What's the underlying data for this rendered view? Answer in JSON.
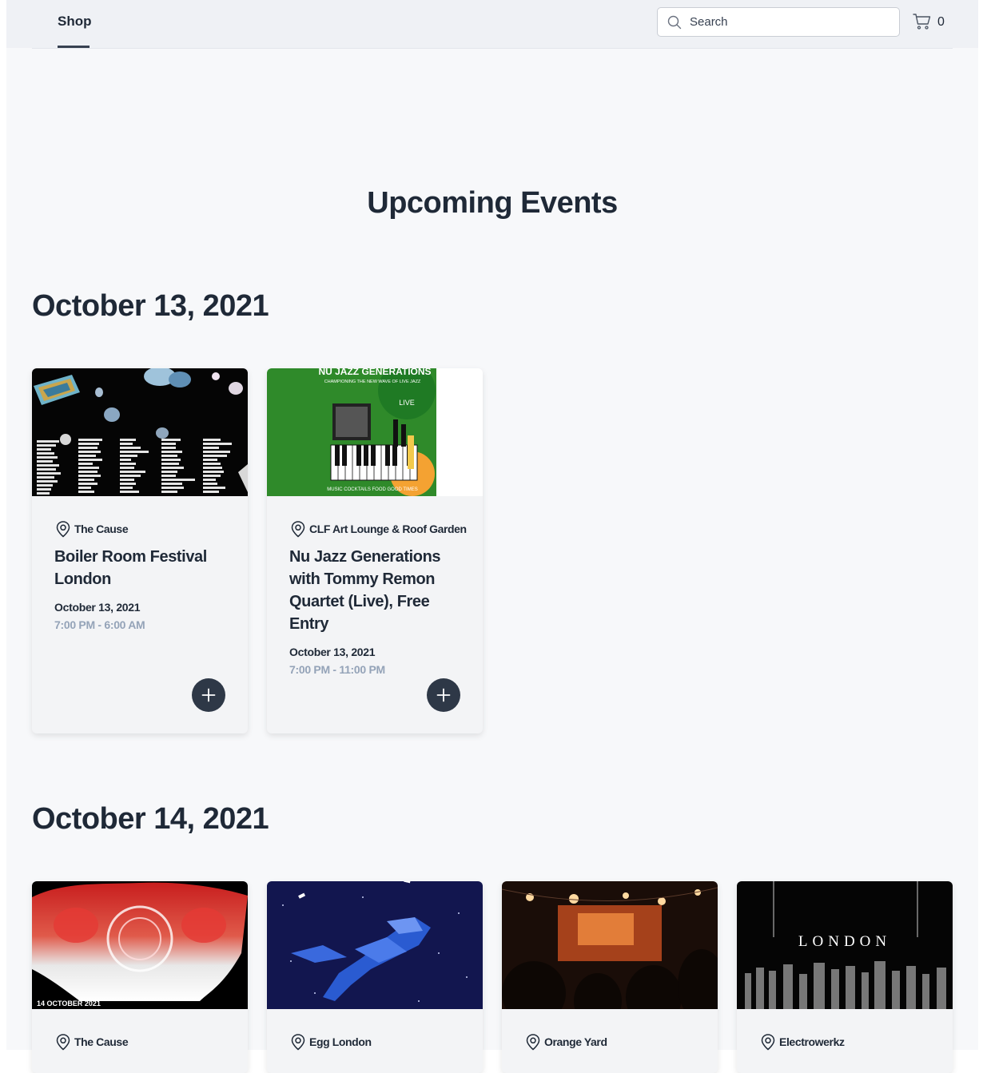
{
  "header": {
    "nav_tab": "Shop",
    "search_placeholder": "Search",
    "cart_count": "0"
  },
  "page_title": "Upcoming Events",
  "days": [
    {
      "date": "October 13, 2021",
      "events": [
        {
          "venue": "The Cause",
          "title": "Boiler Room Festival London",
          "date": "October 13, 2021",
          "time": "7:00 PM - 6:00 AM"
        },
        {
          "venue": "CLF Art Lounge & Roof Garden",
          "title": "Nu Jazz Generations with Tommy Remon Quartet (Live), Free Entry",
          "date": "October 13, 2021",
          "time": "7:00 PM - 11:00 PM",
          "poster_text": "NU JAZZ GENERATIONS",
          "poster_sub": "CHAMPIONING THE NEW WAVE OF LIVE JAZZ",
          "poster_live": "LIVE",
          "poster_footer": "MUSIC COCKTAILS FOOD GOOD TIMES"
        }
      ]
    },
    {
      "date": "October 14, 2021",
      "events": [
        {
          "venue": "The Cause",
          "image_caption": "14 OCTOBER 2021"
        },
        {
          "venue": "Egg London"
        },
        {
          "venue": "Orange Yard"
        },
        {
          "venue": "Electrowerkz",
          "image_caption": "LONDON"
        }
      ]
    }
  ],
  "colors": {
    "page_bg": "#f7f8fa",
    "header_bg": "#eff1f5",
    "card_bg": "#f3f4f6",
    "text": "#1f2937",
    "muted": "#94a3b8",
    "button": "#2e3847"
  }
}
